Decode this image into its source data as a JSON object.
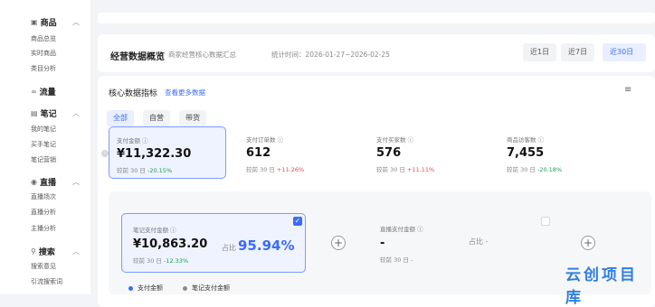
{
  "sidebar": {
    "groups": [
      {
        "label": "商品",
        "items": [
          "商品总览",
          "实时商品",
          "类目分析"
        ]
      },
      {
        "label": "流量",
        "items": []
      },
      {
        "label": "笔记",
        "items": [
          "我的笔记",
          "买手笔记",
          "笔记营销"
        ]
      },
      {
        "label": "直播",
        "items": [
          "直播场次",
          "直播分析",
          "主播分析"
        ]
      },
      {
        "label": "搜索",
        "items": [
          "搜索意见",
          "引流搜索词"
        ]
      }
    ]
  },
  "header": {
    "title": "经营数据概览",
    "subtitle": "商家经营核心数据汇总",
    "range": "统计时间：2026-01-27~2026-02-25",
    "buttons": [
      "近1日",
      "近7日",
      "近30日"
    ]
  },
  "core": {
    "title": "核心数据指标",
    "more_link": "查看更多数据",
    "corner_icon": "≡",
    "tabs": [
      "全部",
      "自营",
      "带货"
    ],
    "compare_label": "较前 30 日",
    "metrics": [
      {
        "label": "支付金额 ⓘ",
        "value": "¥11,322.30",
        "change": "-20.15%"
      },
      {
        "label": "支付订单数 ⓘ",
        "value": "612",
        "change": "+11.26%"
      },
      {
        "label": "支付买家数 ⓘ",
        "value": "576",
        "change": "+11.11%"
      },
      {
        "label": "商品访客数 ⓘ",
        "value": "7,455",
        "change": "-20.18%"
      }
    ]
  },
  "breakdown": {
    "note": {
      "label": "笔记支付金额 ⓘ",
      "value": "¥10,863.20",
      "share_label": "占比",
      "share": "95.94%",
      "change": "-12.33%"
    },
    "live": {
      "label": "直播支付金额 ⓘ",
      "value": "-",
      "share_label": "占比",
      "share": "-",
      "change": "-"
    }
  },
  "legend": [
    "支付金额",
    "笔记支付金额"
  ],
  "colors": {
    "accent": "#3a6bff",
    "down": "#1e9e4a",
    "up": "#e5484d"
  },
  "watermark": "云创项目库"
}
